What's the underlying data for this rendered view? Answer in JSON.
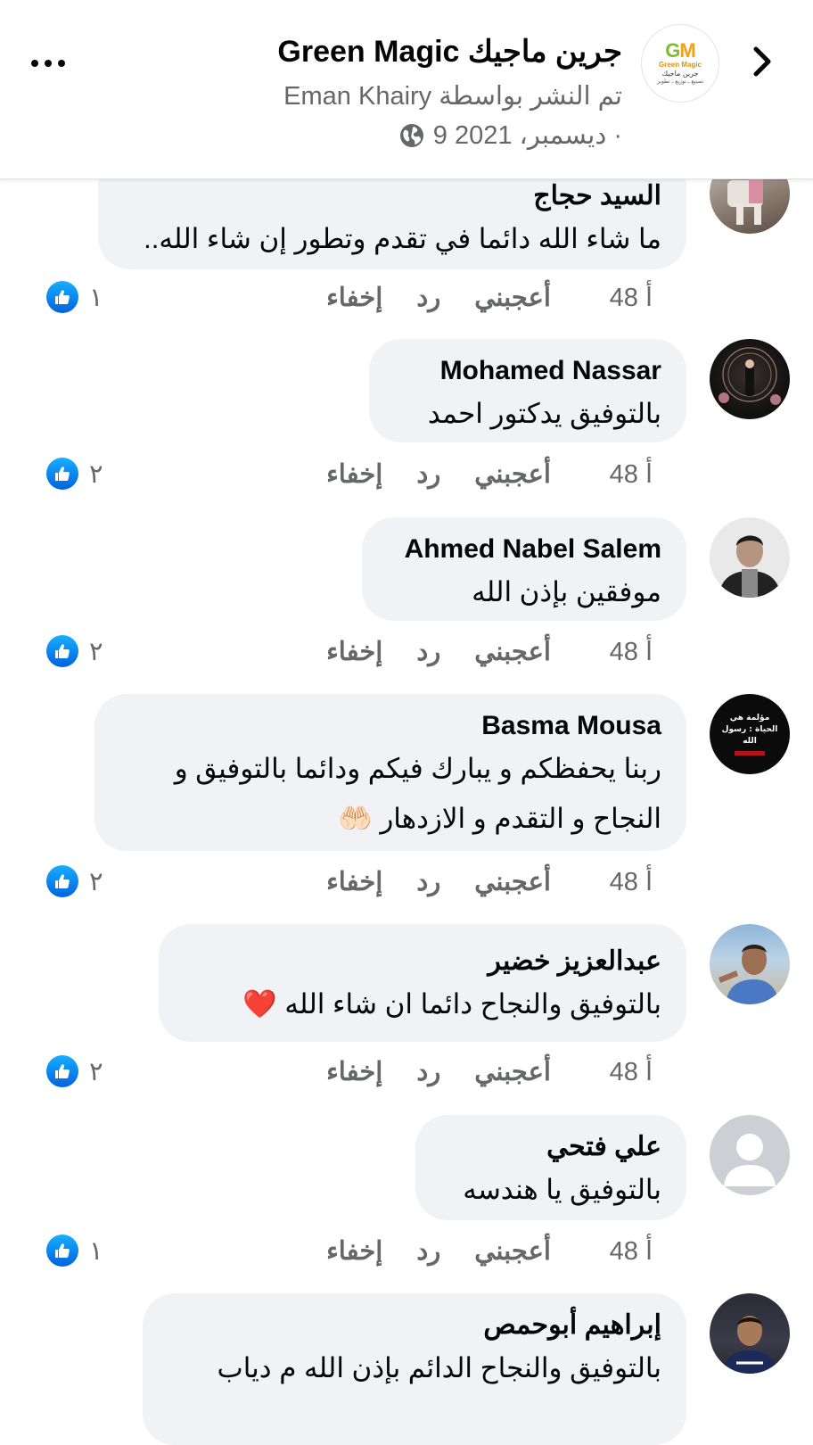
{
  "header": {
    "page_name": "جرين ماجيك Green Magic",
    "posted_by": "تم النشر بواسطة Eman Khairy",
    "date": "9 ديسمبر، 2021 ·",
    "logo": {
      "mark": "GM",
      "english": "Green Magic",
      "arabic": "جرين ماجيك",
      "tagline": "تصنيع ـ توزيع ـ تطوير"
    },
    "icons": {
      "back": "chevron-right-icon",
      "more": "more-dots-icon",
      "privacy": "globe-icon"
    }
  },
  "comments": [
    {
      "author": "السيد حجاج",
      "lines": [
        "ما شاء الله دائما في تقدم وتطور إن شاء الله.."
      ],
      "time": "48 أ",
      "like": "أعجبني",
      "reply": "رد",
      "hide": "إخفاء",
      "reactions": "١"
    },
    {
      "author": "Mohamed Nassar",
      "lines": [
        "بالتوفيق يدكتور احمد"
      ],
      "time": "48 أ",
      "like": "أعجبني",
      "reply": "رد",
      "hide": "إخفاء",
      "reactions": "٢"
    },
    {
      "author": "Ahmed Nabel Salem",
      "lines": [
        "موفقين بإذن الله"
      ],
      "time": "48 أ",
      "like": "أعجبني",
      "reply": "رد",
      "hide": "إخفاء",
      "reactions": "٢"
    },
    {
      "author": "Basma Mousa",
      "lines": [
        "ربنا يحفظكم و يبارك فيكم ودائما بالتوفيق و",
        "النجاح و التقدم و الازدهار 🤲🏻"
      ],
      "avatar_text": "مؤلمة هي الحياة : رسول الله",
      "time": "48 أ",
      "like": "أعجبني",
      "reply": "رد",
      "hide": "إخفاء",
      "reactions": "٢"
    },
    {
      "author": "عبدالعزيز خضير",
      "lines": [
        "بالتوفيق والنجاح دائما ان شاء الله ❤️"
      ],
      "time": "48 أ",
      "like": "أعجبني",
      "reply": "رد",
      "hide": "إخفاء",
      "reactions": "٢"
    },
    {
      "author": "علي فتحي",
      "lines": [
        "بالتوفيق يا هندسه"
      ],
      "time": "48 أ",
      "like": "أعجبني",
      "reply": "رد",
      "hide": "إخفاء",
      "reactions": "١"
    },
    {
      "author": "إبراهيم أبوحمص",
      "lines": [
        "بالتوفيق والنجاح الدائم بإذن الله م دياب"
      ]
    }
  ],
  "colors": {
    "bubble_bg": "#f0f2f5",
    "secondary_text": "#65676b",
    "like_blue": "#1877f2"
  }
}
